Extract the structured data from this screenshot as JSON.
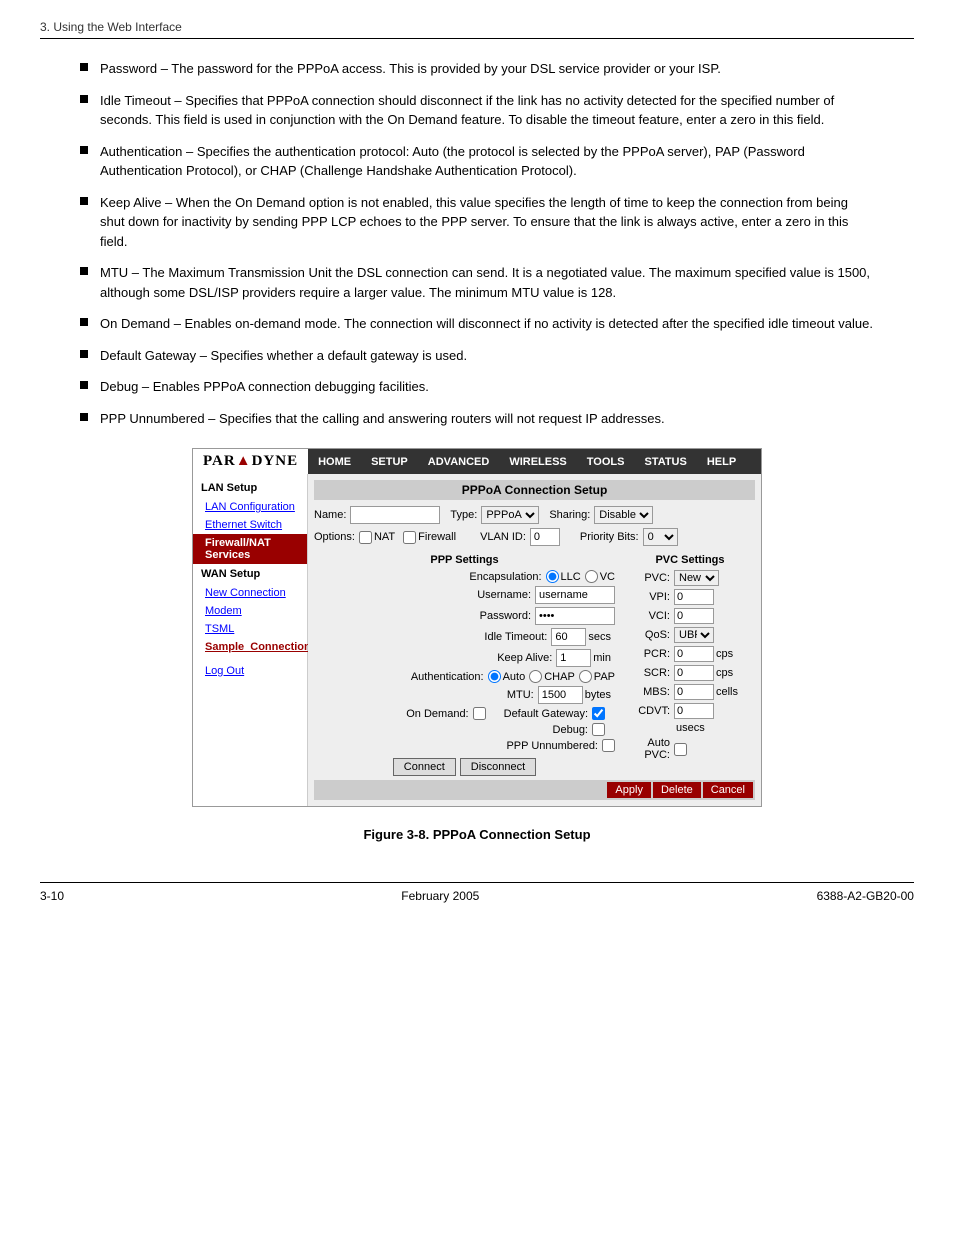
{
  "page": {
    "header": "3. Using the Web Interface",
    "footer_left": "3-10",
    "footer_center": "February 2005",
    "footer_right": "6388-A2-GB20-00"
  },
  "bullets": [
    {
      "id": "password",
      "text": "Password – The password for the PPPoA access. This is provided by your DSL service provider or your ISP."
    },
    {
      "id": "idle_timeout",
      "text": "Idle Timeout – Specifies that PPPoA connection should disconnect if the link has no activity detected for the specified number of seconds. This field is used in conjunction with the On Demand feature. To disable the timeout feature, enter a zero in this field."
    },
    {
      "id": "authentication",
      "text": "Authentication – Specifies the authentication protocol: Auto (the protocol is selected by the PPPoA server), PAP (Password Authentication Protocol), or CHAP (Challenge Handshake Authentication Protocol)."
    },
    {
      "id": "keep_alive",
      "text": "Keep Alive – When the On Demand option is not enabled, this value specifies the length of time to keep the connection from being shut down for inactivity by sending PPP LCP echoes to the PPP server. To ensure that the link is always active, enter a zero in this field."
    },
    {
      "id": "mtu",
      "text": "MTU – The Maximum Transmission Unit the DSL connection can send. It is a negotiated value. The maximum specified value is 1500, although some DSL/ISP providers require a larger value. The minimum MTU value is 128."
    },
    {
      "id": "on_demand",
      "text": "On Demand – Enables on-demand mode. The connection will disconnect if no activity is detected after the specified idle timeout value."
    },
    {
      "id": "default_gateway",
      "text": "Default Gateway – Specifies whether a default gateway is used."
    },
    {
      "id": "debug",
      "text": "Debug – Enables PPPoA connection debugging facilities."
    },
    {
      "id": "ppp_unnumbered",
      "text": "PPP Unnumbered – Specifies that the calling and answering routers will not request IP addresses."
    }
  ],
  "router_ui": {
    "logo_text": "PAR",
    "logo_text2": "A",
    "logo_text3": "DYNE",
    "nav_items": [
      "HOME",
      "SETUP",
      "ADVANCED",
      "WIRELESS",
      "TOOLS",
      "STATUS",
      "HELP"
    ],
    "sidebar": {
      "sections": [
        {
          "label": "LAN Setup",
          "items": [
            {
              "label": "LAN Configuration",
              "active": false
            },
            {
              "label": "Ethernet Switch",
              "active": false
            },
            {
              "label": "Firewall/NAT Services",
              "active": true
            }
          ]
        },
        {
          "label": "WAN Setup",
          "items": [
            {
              "label": "New Connection",
              "active": false,
              "highlight": false
            },
            {
              "label": "Modem",
              "active": false
            },
            {
              "label": "TSML",
              "active": false
            },
            {
              "label": "Sample_Connection",
              "active": false
            }
          ]
        },
        {
          "label": "",
          "items": [
            {
              "label": "Log Out",
              "active": false
            }
          ]
        }
      ]
    },
    "main": {
      "title": "PPPoA Connection Setup",
      "name_label": "Name:",
      "name_value": "",
      "type_label": "Type:",
      "type_value": "PPPoA",
      "sharing_label": "Sharing:",
      "sharing_value": "Disable",
      "options_label": "Options:",
      "nat_label": "NAT",
      "firewall_label": "Firewall",
      "vlan_id_label": "VLAN ID:",
      "vlan_id_value": "0",
      "priority_bits_label": "Priority Bits:",
      "priority_bits_value": "0",
      "ppp_settings_title": "PPP Settings",
      "encapsulation_label": "Encapsulation:",
      "llc_label": "LLC",
      "vc_label": "VC",
      "username_label": "Username:",
      "username_value": "username",
      "password_label": "Password:",
      "password_value": "****",
      "idle_timeout_label": "Idle Timeout:",
      "idle_timeout_value": "60",
      "idle_timeout_unit": "secs",
      "keep_alive_label": "Keep Alive:",
      "keep_alive_value": "1",
      "keep_alive_unit": "min",
      "auth_label": "Authentication:",
      "auth_auto": "Auto",
      "auth_chap": "CHAP",
      "auth_pap": "PAP",
      "mtu_label": "MTU:",
      "mtu_value": "1500",
      "mtu_unit": "bytes",
      "on_demand_label": "On Demand:",
      "default_gateway_label": "Default Gateway:",
      "debug_label": "Debug:",
      "ppp_unnumbered_label": "PPP Unnumbered:",
      "connect_btn": "Connect",
      "disconnect_btn": "Disconnect",
      "pvc_settings_title": "PVC Settings",
      "pvc_label": "PVC:",
      "pvc_value": "New",
      "vpi_label": "VPI:",
      "vpi_value": "0",
      "vci_label": "VCI:",
      "vci_value": "0",
      "qos_label": "QoS:",
      "qos_value": "UBR",
      "pcr_label": "PCR:",
      "pcr_value": "0",
      "pcr_unit": "cps",
      "scr_label": "SCR:",
      "scr_value": "0",
      "scr_unit": "cps",
      "mbs_label": "MBS:",
      "mbs_value": "0",
      "mbs_unit": "cells",
      "cdvt_label": "CDVT:",
      "cdvt_value": "0",
      "cdvt_unit": "usecs",
      "auto_pvc_label": "Auto PVC:",
      "apply_btn": "Apply",
      "delete_btn": "Delete",
      "cancel_btn": "Cancel"
    }
  },
  "figure_caption": "Figure 3-8.     PPPoA Connection Setup"
}
